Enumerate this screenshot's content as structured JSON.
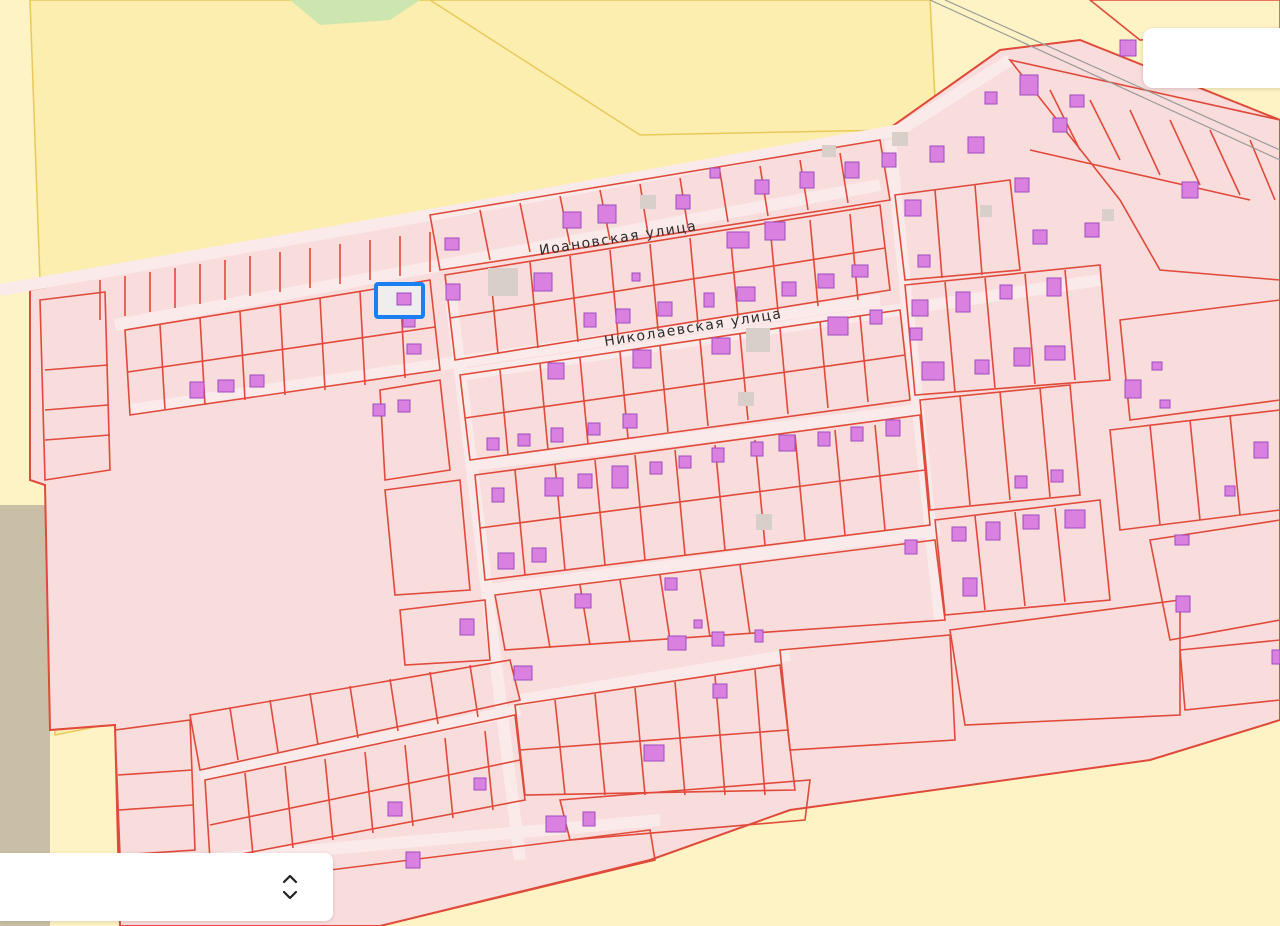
{
  "map": {
    "streets": {
      "ioanovskaya": "Иоановская улица",
      "nikolaevskaya": "Николаевская улица"
    },
    "colors": {
      "background": "#fdf3c4",
      "field_border": "#e8c95a",
      "parcel_fill": "#f9dcdc",
      "parcel_stroke": "#e04a3a",
      "building": "#d980e0",
      "building_stroke": "#a04cc0",
      "selected": "#1a7ff0",
      "gray_area": "#c9bfa6",
      "green_area": "#cde6b0"
    }
  },
  "controls": {
    "search_box": "search-panel",
    "stepper_icon": "up-down-chevron-icon"
  }
}
